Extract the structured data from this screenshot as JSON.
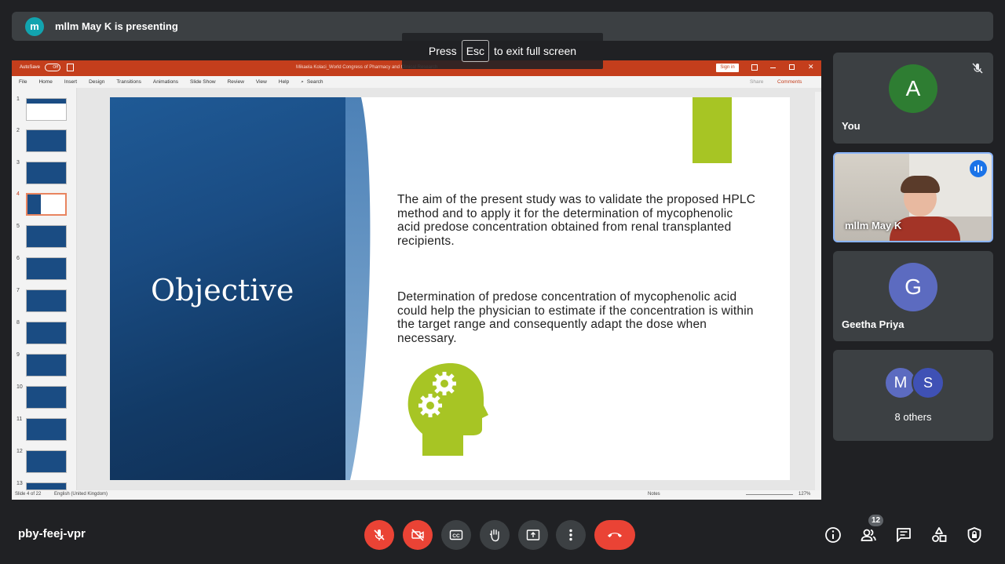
{
  "presenter": {
    "initial": "m",
    "text": "mllm May K is presenting"
  },
  "toast": {
    "before": "Press",
    "key": "Esc",
    "after": "to exit full screen"
  },
  "ppt": {
    "autosave": "AutoSave",
    "autosave_state": "Off",
    "doc_title": "Mikaela Kolaci_World Congress of  Pharmacy and Clinical Research",
    "sign_in": "Sign in",
    "menu": [
      "File",
      "Home",
      "Insert",
      "Design",
      "Transitions",
      "Animations",
      "Slide Show",
      "Review",
      "View",
      "Help"
    ],
    "search": "Search",
    "share": "Share",
    "comments": "Comments",
    "thumb_numbers": [
      "1",
      "2",
      "3",
      "4",
      "5",
      "6",
      "7",
      "8",
      "9",
      "10",
      "11",
      "12",
      "13"
    ],
    "status_left": "Slide 4 of 22",
    "status_lang": "English (United Kingdom)",
    "notes": "Notes",
    "zoom": "127%"
  },
  "slide": {
    "title": "Objective",
    "para1": "The aim of the present study was to validate the proposed HPLC method and to apply it for the determination of mycophenolic acid predose concentration obtained from renal transplanted recipients.",
    "para2": "Determination of predose concentration of mycophenolic acid could help the physician to estimate if the concentration is within the target range and consequently adapt the dose when necessary.",
    "accent_color": "#a7c524"
  },
  "tiles": {
    "you": {
      "initial": "A",
      "name": "You",
      "color": "#2e7d32"
    },
    "presenter": {
      "name": "mllm May K"
    },
    "geetha": {
      "initial": "G",
      "name": "Geetha Priya",
      "color": "#5c6bc0"
    },
    "others": {
      "initials": [
        "M",
        "S"
      ],
      "label": "8 others"
    }
  },
  "bottom": {
    "meeting_code": "pby-feej-vpr",
    "people_count": "12"
  }
}
